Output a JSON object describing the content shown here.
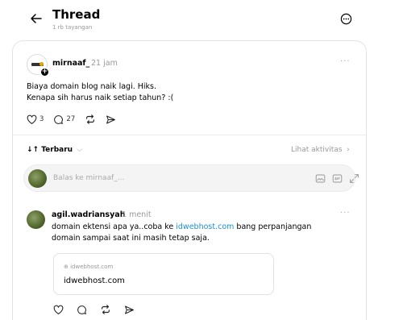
{
  "header": {
    "title": "Thread",
    "subtitle": "1 rb tayangan"
  },
  "post": {
    "author": "mirnaaf_",
    "time": "21 jam",
    "more": "···",
    "text_line1": "Biaya domain blog naik lagi. Hiks.",
    "text_line2": "Kenapa sih harus naik setiap tahun? :(",
    "like_count": "3",
    "comment_count": "27"
  },
  "sort": {
    "label": "Terbaru",
    "activity_label": "Lihat aktivitas"
  },
  "reply": {
    "placeholder": "Balas ke mirnaaf_..."
  },
  "comment": {
    "author": "agil.wadriansyah",
    "time": "1 menit",
    "more": "···",
    "text_before_link": "domain ektensi apa ya..coba ke ",
    "link_text": "idwebhost.com",
    "text_after_link": " bang perpanjangan domain sampai saat ini masih tetap saja.",
    "link_preview": {
      "domain": "idwebhost.com",
      "title": "idwebhost.com"
    }
  },
  "colors": {
    "link": "#1d8fd6",
    "muted": "#999999",
    "border": "#e3e3e3"
  }
}
